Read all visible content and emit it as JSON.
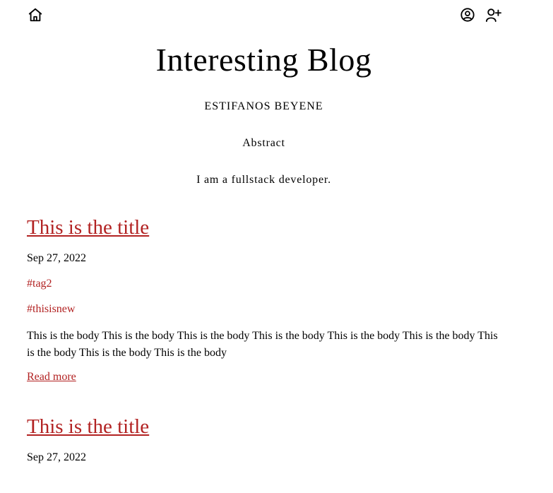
{
  "nav": {
    "home_icon": "home-icon",
    "account_icon": "user-circle-icon",
    "add_user_icon": "user-plus-icon"
  },
  "blog": {
    "title": "Interesting Blog",
    "author": "ESTIFANOS BEYENE",
    "abstract_label": "Abstract",
    "abstract_text": "I am a fullstack developer."
  },
  "colors": {
    "link": "#b22222",
    "text": "#000000"
  },
  "posts": [
    {
      "title": "This is the title",
      "date": "Sep 27, 2022",
      "tags": [
        "#tag2",
        "#thisisnew"
      ],
      "body": "This is the body This is the body This is the body This is the body This is the body This is the body This is the body This is the body This is the body",
      "read_more": "Read more"
    },
    {
      "title": "This is the title",
      "date": "Sep 27, 2022"
    }
  ]
}
